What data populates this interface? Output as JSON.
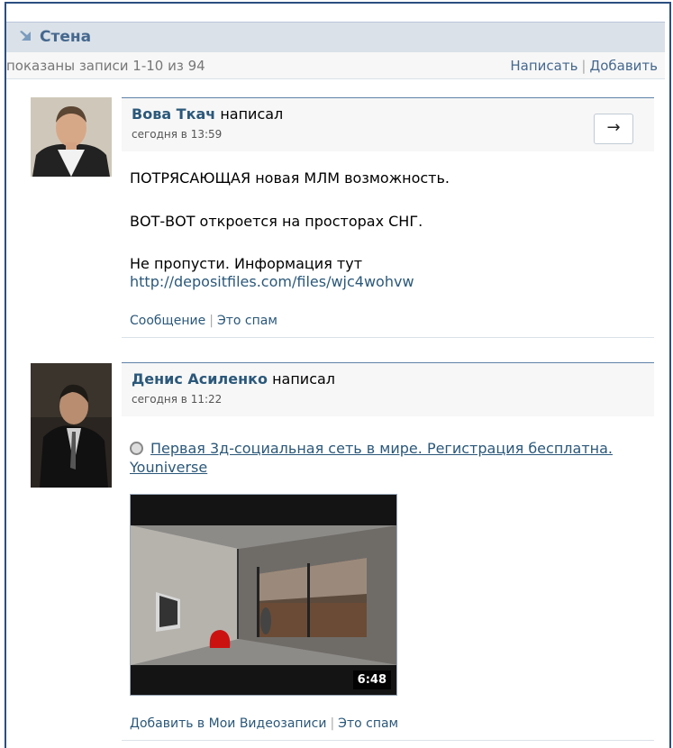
{
  "wall": {
    "title": "Стена",
    "summary": "показаны записи 1-10 из 94",
    "write_label": "Написать",
    "add_label": "Добавить"
  },
  "posts": [
    {
      "author": "Вова Ткач",
      "verb": "написал",
      "time": "сегодня в 13:59",
      "reply_arrow": "→",
      "lines": [
        "ПОТРЯСАЮЩАЯ новая МЛМ возможность.",
        "ВОТ-ВОТ откроется на просторах СНГ.",
        "Не пропусти. Информация тут"
      ],
      "link": "http://depositfiles.com/files/wjc4wohvw",
      "action_message": "Сообщение",
      "action_spam": "Это спам"
    },
    {
      "author": "Денис Асиленко",
      "verb": "написал",
      "time": "сегодня в 11:22",
      "share_text": "Первая 3д-социальная сеть в мире. Регистрация бесплатна. Youniverse",
      "video_duration": "6:48",
      "action_add_video": "Добавить в Мои Видеозаписи",
      "action_spam": "Это спам"
    }
  ],
  "colors": {
    "frame": "#2b4f80",
    "header_bg": "#dae1e8",
    "link": "#2b587a",
    "title": "#45688e"
  },
  "icons": {
    "wall": "wall-arrow-icon",
    "reply": "arrow-right-icon",
    "share": "globe-icon"
  }
}
